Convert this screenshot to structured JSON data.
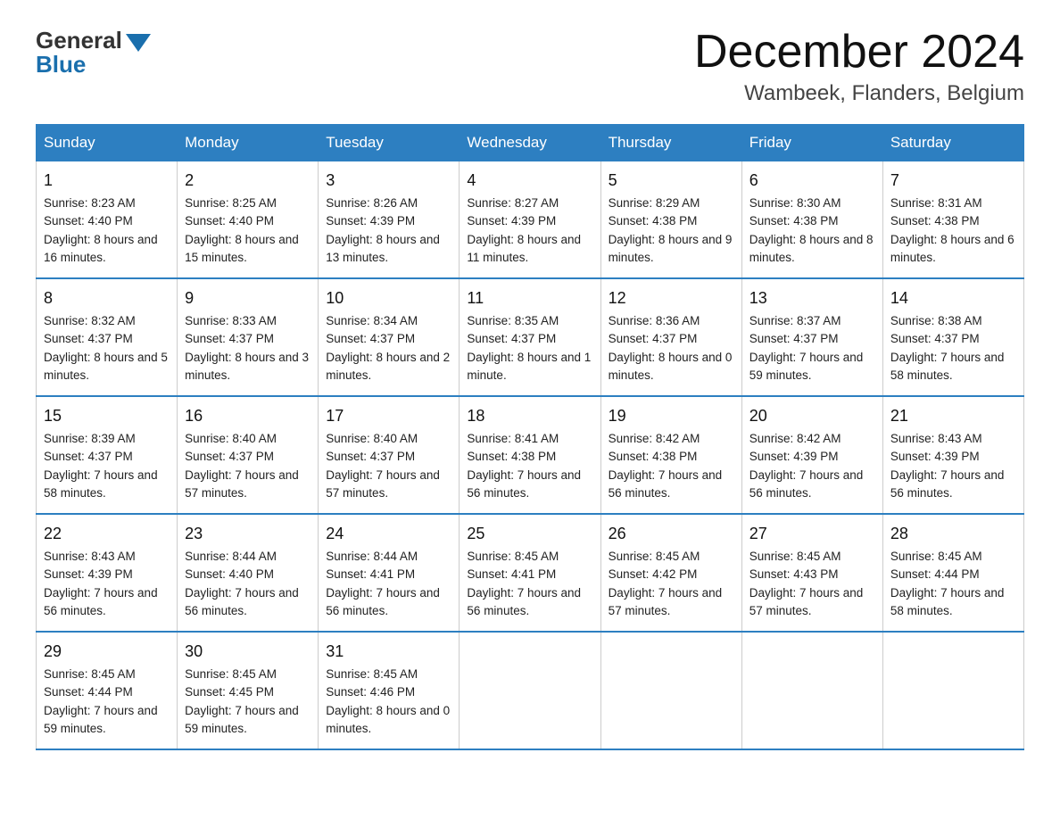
{
  "logo": {
    "general": "General",
    "blue": "Blue"
  },
  "title": "December 2024",
  "subtitle": "Wambeek, Flanders, Belgium",
  "weekdays": [
    "Sunday",
    "Monday",
    "Tuesday",
    "Wednesday",
    "Thursday",
    "Friday",
    "Saturday"
  ],
  "weeks": [
    [
      {
        "day": "1",
        "sunrise": "8:23 AM",
        "sunset": "4:40 PM",
        "daylight": "8 hours and 16 minutes."
      },
      {
        "day": "2",
        "sunrise": "8:25 AM",
        "sunset": "4:40 PM",
        "daylight": "8 hours and 15 minutes."
      },
      {
        "day": "3",
        "sunrise": "8:26 AM",
        "sunset": "4:39 PM",
        "daylight": "8 hours and 13 minutes."
      },
      {
        "day": "4",
        "sunrise": "8:27 AM",
        "sunset": "4:39 PM",
        "daylight": "8 hours and 11 minutes."
      },
      {
        "day": "5",
        "sunrise": "8:29 AM",
        "sunset": "4:38 PM",
        "daylight": "8 hours and 9 minutes."
      },
      {
        "day": "6",
        "sunrise": "8:30 AM",
        "sunset": "4:38 PM",
        "daylight": "8 hours and 8 minutes."
      },
      {
        "day": "7",
        "sunrise": "8:31 AM",
        "sunset": "4:38 PM",
        "daylight": "8 hours and 6 minutes."
      }
    ],
    [
      {
        "day": "8",
        "sunrise": "8:32 AM",
        "sunset": "4:37 PM",
        "daylight": "8 hours and 5 minutes."
      },
      {
        "day": "9",
        "sunrise": "8:33 AM",
        "sunset": "4:37 PM",
        "daylight": "8 hours and 3 minutes."
      },
      {
        "day": "10",
        "sunrise": "8:34 AM",
        "sunset": "4:37 PM",
        "daylight": "8 hours and 2 minutes."
      },
      {
        "day": "11",
        "sunrise": "8:35 AM",
        "sunset": "4:37 PM",
        "daylight": "8 hours and 1 minute."
      },
      {
        "day": "12",
        "sunrise": "8:36 AM",
        "sunset": "4:37 PM",
        "daylight": "8 hours and 0 minutes."
      },
      {
        "day": "13",
        "sunrise": "8:37 AM",
        "sunset": "4:37 PM",
        "daylight": "7 hours and 59 minutes."
      },
      {
        "day": "14",
        "sunrise": "8:38 AM",
        "sunset": "4:37 PM",
        "daylight": "7 hours and 58 minutes."
      }
    ],
    [
      {
        "day": "15",
        "sunrise": "8:39 AM",
        "sunset": "4:37 PM",
        "daylight": "7 hours and 58 minutes."
      },
      {
        "day": "16",
        "sunrise": "8:40 AM",
        "sunset": "4:37 PM",
        "daylight": "7 hours and 57 minutes."
      },
      {
        "day": "17",
        "sunrise": "8:40 AM",
        "sunset": "4:37 PM",
        "daylight": "7 hours and 57 minutes."
      },
      {
        "day": "18",
        "sunrise": "8:41 AM",
        "sunset": "4:38 PM",
        "daylight": "7 hours and 56 minutes."
      },
      {
        "day": "19",
        "sunrise": "8:42 AM",
        "sunset": "4:38 PM",
        "daylight": "7 hours and 56 minutes."
      },
      {
        "day": "20",
        "sunrise": "8:42 AM",
        "sunset": "4:39 PM",
        "daylight": "7 hours and 56 minutes."
      },
      {
        "day": "21",
        "sunrise": "8:43 AM",
        "sunset": "4:39 PM",
        "daylight": "7 hours and 56 minutes."
      }
    ],
    [
      {
        "day": "22",
        "sunrise": "8:43 AM",
        "sunset": "4:39 PM",
        "daylight": "7 hours and 56 minutes."
      },
      {
        "day": "23",
        "sunrise": "8:44 AM",
        "sunset": "4:40 PM",
        "daylight": "7 hours and 56 minutes."
      },
      {
        "day": "24",
        "sunrise": "8:44 AM",
        "sunset": "4:41 PM",
        "daylight": "7 hours and 56 minutes."
      },
      {
        "day": "25",
        "sunrise": "8:45 AM",
        "sunset": "4:41 PM",
        "daylight": "7 hours and 56 minutes."
      },
      {
        "day": "26",
        "sunrise": "8:45 AM",
        "sunset": "4:42 PM",
        "daylight": "7 hours and 57 minutes."
      },
      {
        "day": "27",
        "sunrise": "8:45 AM",
        "sunset": "4:43 PM",
        "daylight": "7 hours and 57 minutes."
      },
      {
        "day": "28",
        "sunrise": "8:45 AM",
        "sunset": "4:44 PM",
        "daylight": "7 hours and 58 minutes."
      }
    ],
    [
      {
        "day": "29",
        "sunrise": "8:45 AM",
        "sunset": "4:44 PM",
        "daylight": "7 hours and 59 minutes."
      },
      {
        "day": "30",
        "sunrise": "8:45 AM",
        "sunset": "4:45 PM",
        "daylight": "7 hours and 59 minutes."
      },
      {
        "day": "31",
        "sunrise": "8:45 AM",
        "sunset": "4:46 PM",
        "daylight": "8 hours and 0 minutes."
      },
      null,
      null,
      null,
      null
    ]
  ],
  "labels": {
    "sunrise": "Sunrise:",
    "sunset": "Sunset:",
    "daylight": "Daylight:"
  }
}
